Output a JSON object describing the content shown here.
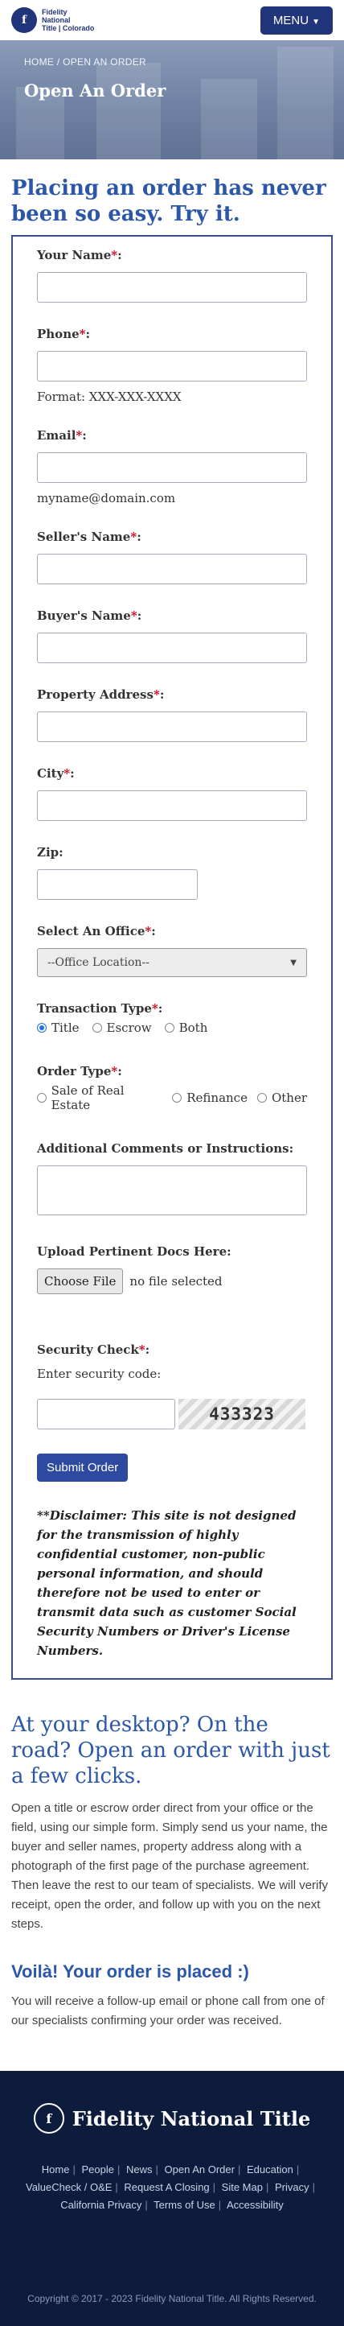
{
  "header": {
    "logo_lines": [
      "Fidelity",
      "National",
      "Title | Colorado"
    ],
    "menu_label": "MENU"
  },
  "hero": {
    "breadcrumb": "HOME / OPEN AN ORDER",
    "title": "Open An Order"
  },
  "intro": {
    "heading": "Placing an order has never been so easy. Try it."
  },
  "form": {
    "your_name_label": "Your Name",
    "phone_label": "Phone",
    "phone_hint": "Format: XXX-XXX-XXXX",
    "email_label": "Email",
    "email_hint": "myname@domain.com",
    "seller_label": "Seller's Name",
    "buyer_label": "Buyer's Name",
    "property_label": "Property Address",
    "city_label": "City",
    "zip_label": "Zip:",
    "office_label": "Select An Office",
    "office_selected": "--Office Location--",
    "transaction_label": "Transaction Type",
    "transaction_options": [
      "Title",
      "Escrow",
      "Both"
    ],
    "order_type_label": "Order Type",
    "order_type_options": [
      "Sale of Real Estate",
      "Refinance",
      "Other"
    ],
    "comments_label": "Additional Comments or Instructions:",
    "upload_label": "Upload Pertinent Docs Here:",
    "choose_file": "Choose File",
    "no_file": "no file selected",
    "security_label": "Security Check",
    "security_prompt": "Enter security code:",
    "captcha_code": "433323",
    "submit_label": "Submit Order",
    "required_mark": "*",
    "colon": ":",
    "disclaimer": "**Disclaimer: This site is not designed for the transmission of highly confidential customer, non-public personal information, and should therefore not be used to enter or transmit data such as customer Social Security Numbers or Driver's License Numbers."
  },
  "info": {
    "heading": "At your desktop? On the road? Open an order with just a few clicks.",
    "paragraph": "Open a title or escrow order direct from your office or the field, using our simple form. Simply send us your name, the buyer and seller names, property address along with a photograph of the first page of the purchase agreement. Then leave the rest to our team of specialists. We will verify receipt, open the order, and follow up with you on the next steps.",
    "voila_heading": "Voilà! Your order is placed :)",
    "voila_paragraph": "You will receive a follow-up email or phone call from one of our specialists confirming your order was received."
  },
  "footer": {
    "brand": "Fidelity National Title",
    "links": [
      "Home",
      "People",
      "News",
      "Open An Order",
      "Education",
      "ValueCheck / O&E",
      "Request A Closing",
      "Site Map",
      "Privacy",
      "California Privacy",
      "Terms of Use",
      "Accessibility"
    ],
    "copyright": "Copyright © 2017 - 2023 Fidelity National Title. All Rights Reserved."
  },
  "colors": {
    "brand_navy": "#21357a",
    "heading_blue": "#2c57a8",
    "footer_bg": "#0d1b3d",
    "required_red": "#d0021b"
  }
}
